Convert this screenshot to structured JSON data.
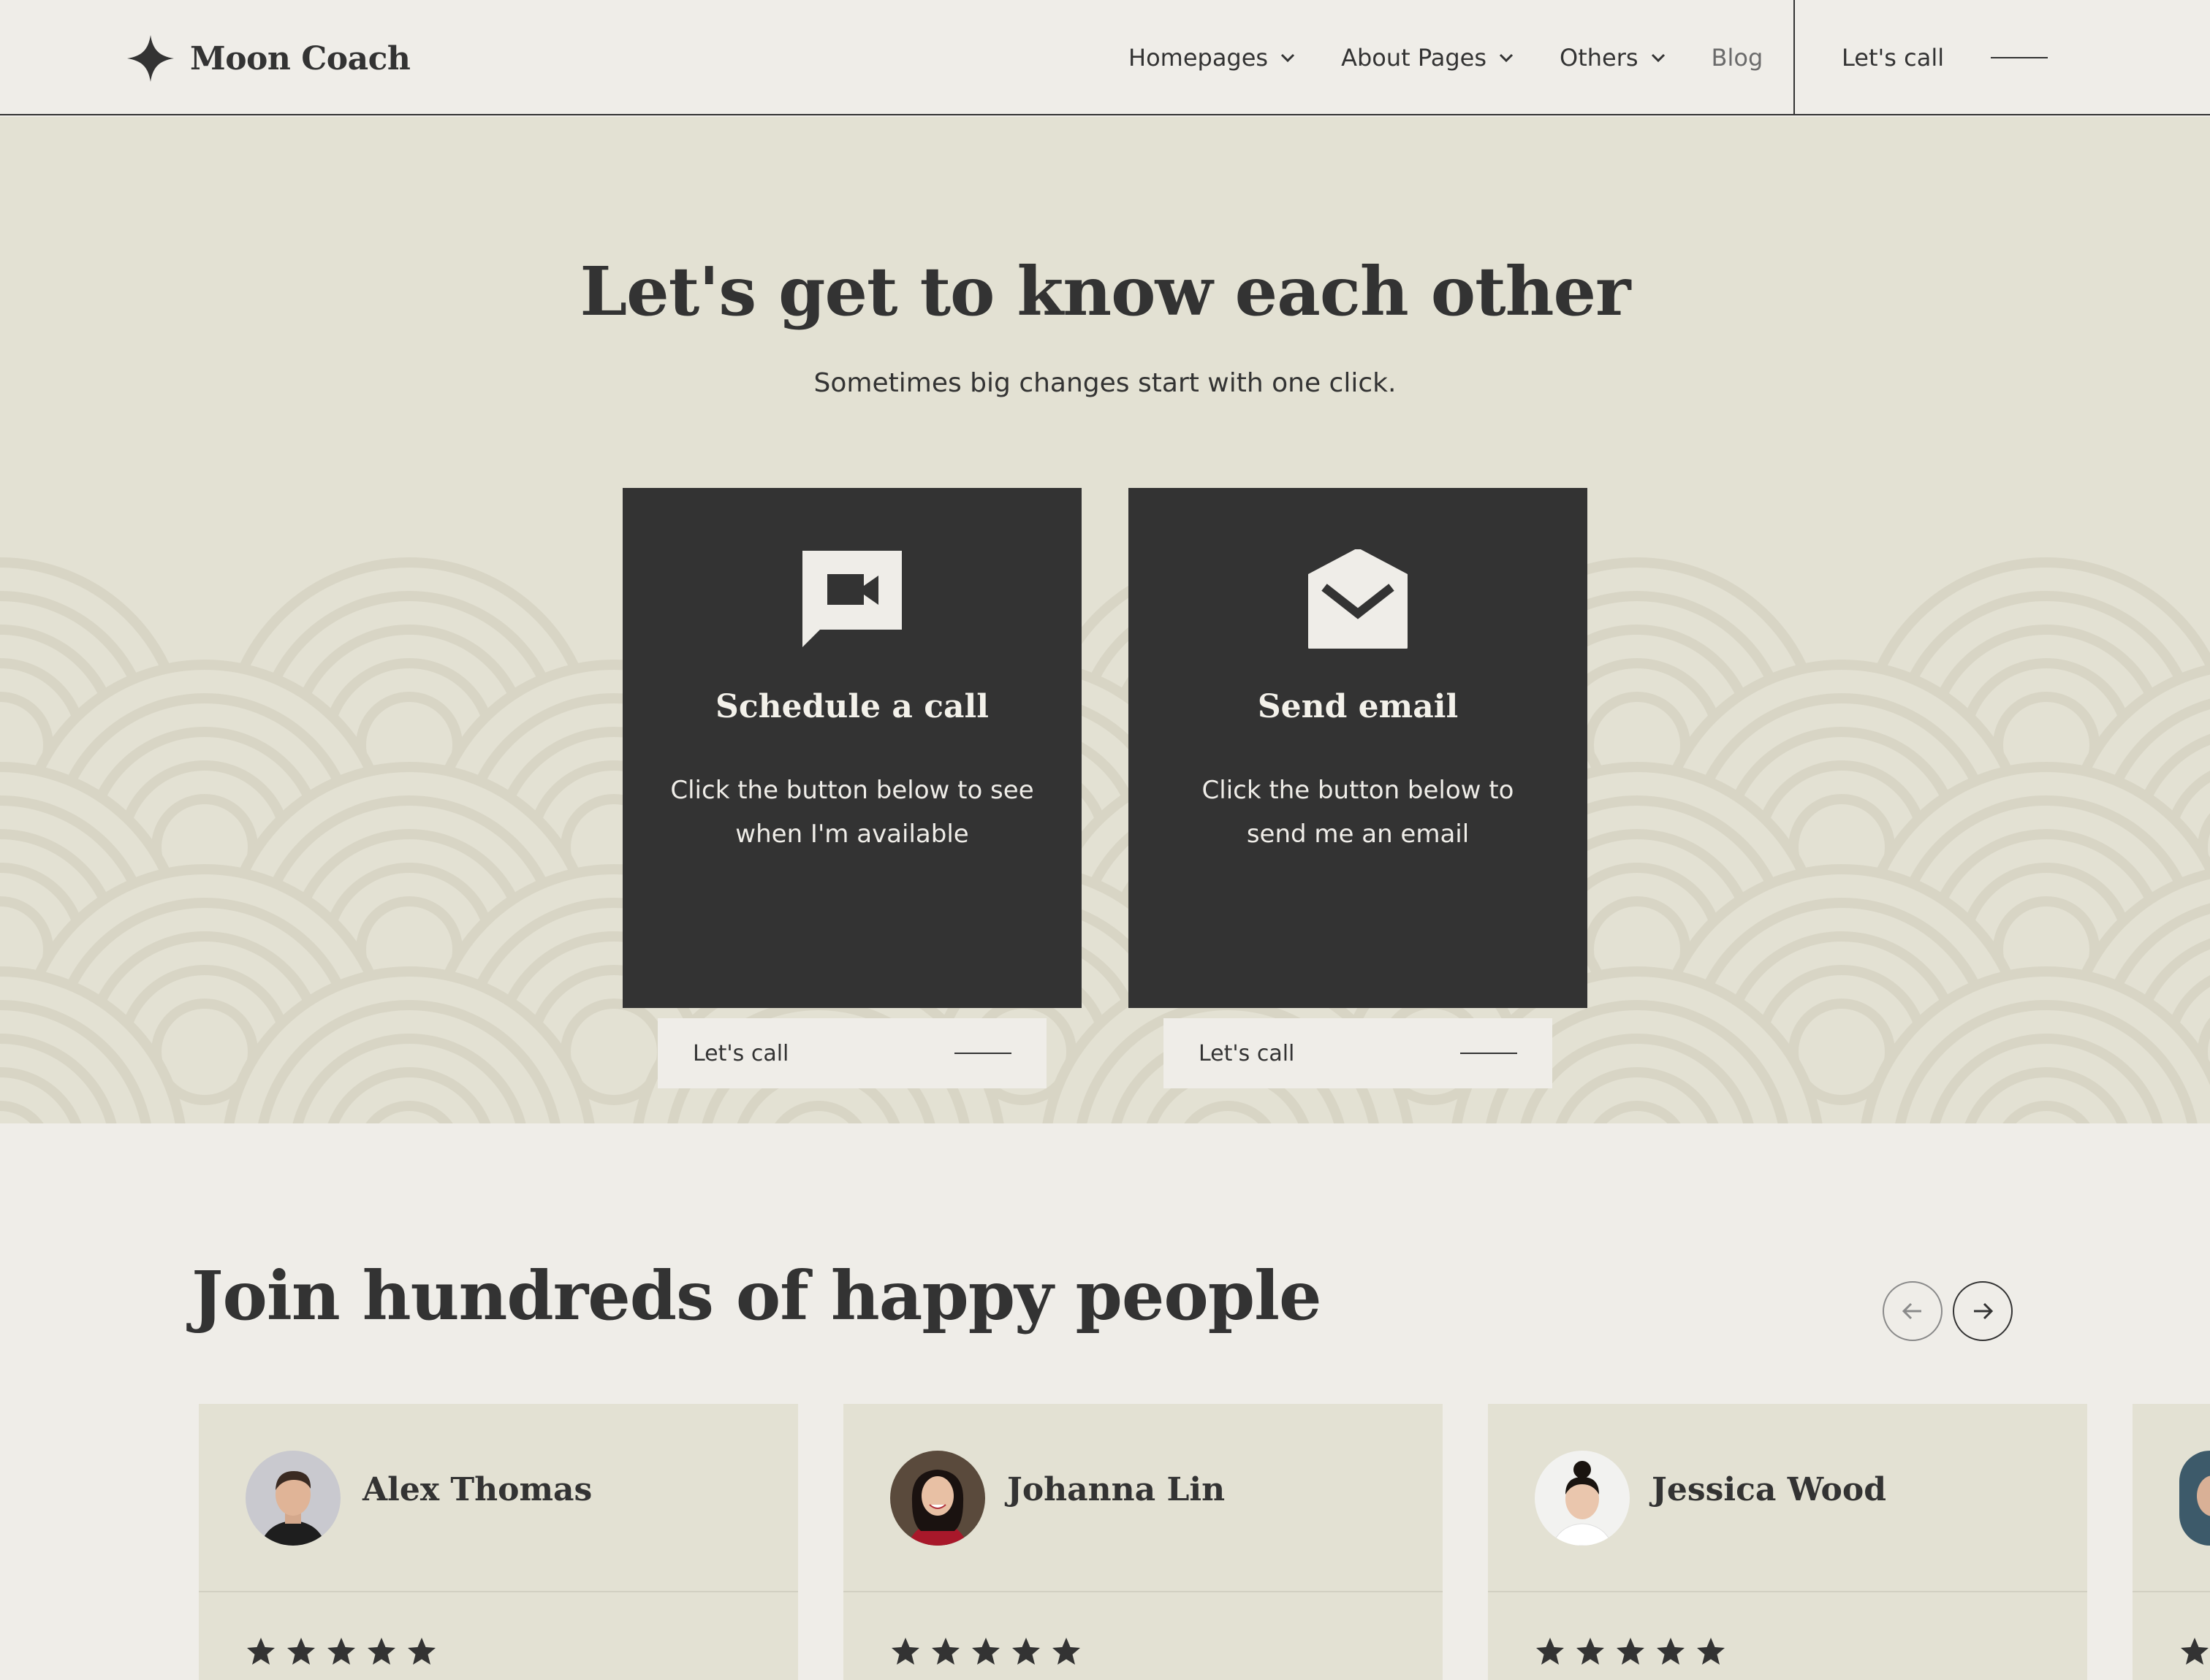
{
  "brand": {
    "name": "Moon Coach",
    "logo_icon": "four-point-star-icon"
  },
  "nav": {
    "items": [
      {
        "label": "Homepages",
        "has_dropdown": true
      },
      {
        "label": "About Pages",
        "has_dropdown": true
      },
      {
        "label": "Others",
        "has_dropdown": true
      },
      {
        "label": "Blog",
        "has_dropdown": false
      }
    ],
    "cta_label": "Let's call"
  },
  "hero": {
    "title": "Let's get to know each other",
    "subtitle": "Sometimes big changes start with one click.",
    "cards": [
      {
        "icon": "video-chat-icon",
        "title": "Schedule a call",
        "text": "Click the button below to see when I'm available",
        "button_label": "Let's call"
      },
      {
        "icon": "envelope-icon",
        "title": "Send email",
        "text": "Click the button below to send me an email",
        "button_label": "Let's call"
      }
    ]
  },
  "testimonials": {
    "title": "Join hundreds of happy people",
    "prev_icon": "arrow-left-icon",
    "next_icon": "arrow-right-icon",
    "items": [
      {
        "name": "Alex Thomas",
        "rating": 5
      },
      {
        "name": "Johanna Lin",
        "rating": 5
      },
      {
        "name": "Jessica Wood",
        "rating": 5
      }
    ]
  },
  "colors": {
    "page_bg": "#efede8",
    "hero_bg": "#e3e1d3",
    "dark": "#333333",
    "pattern": "#d8d5c5"
  }
}
